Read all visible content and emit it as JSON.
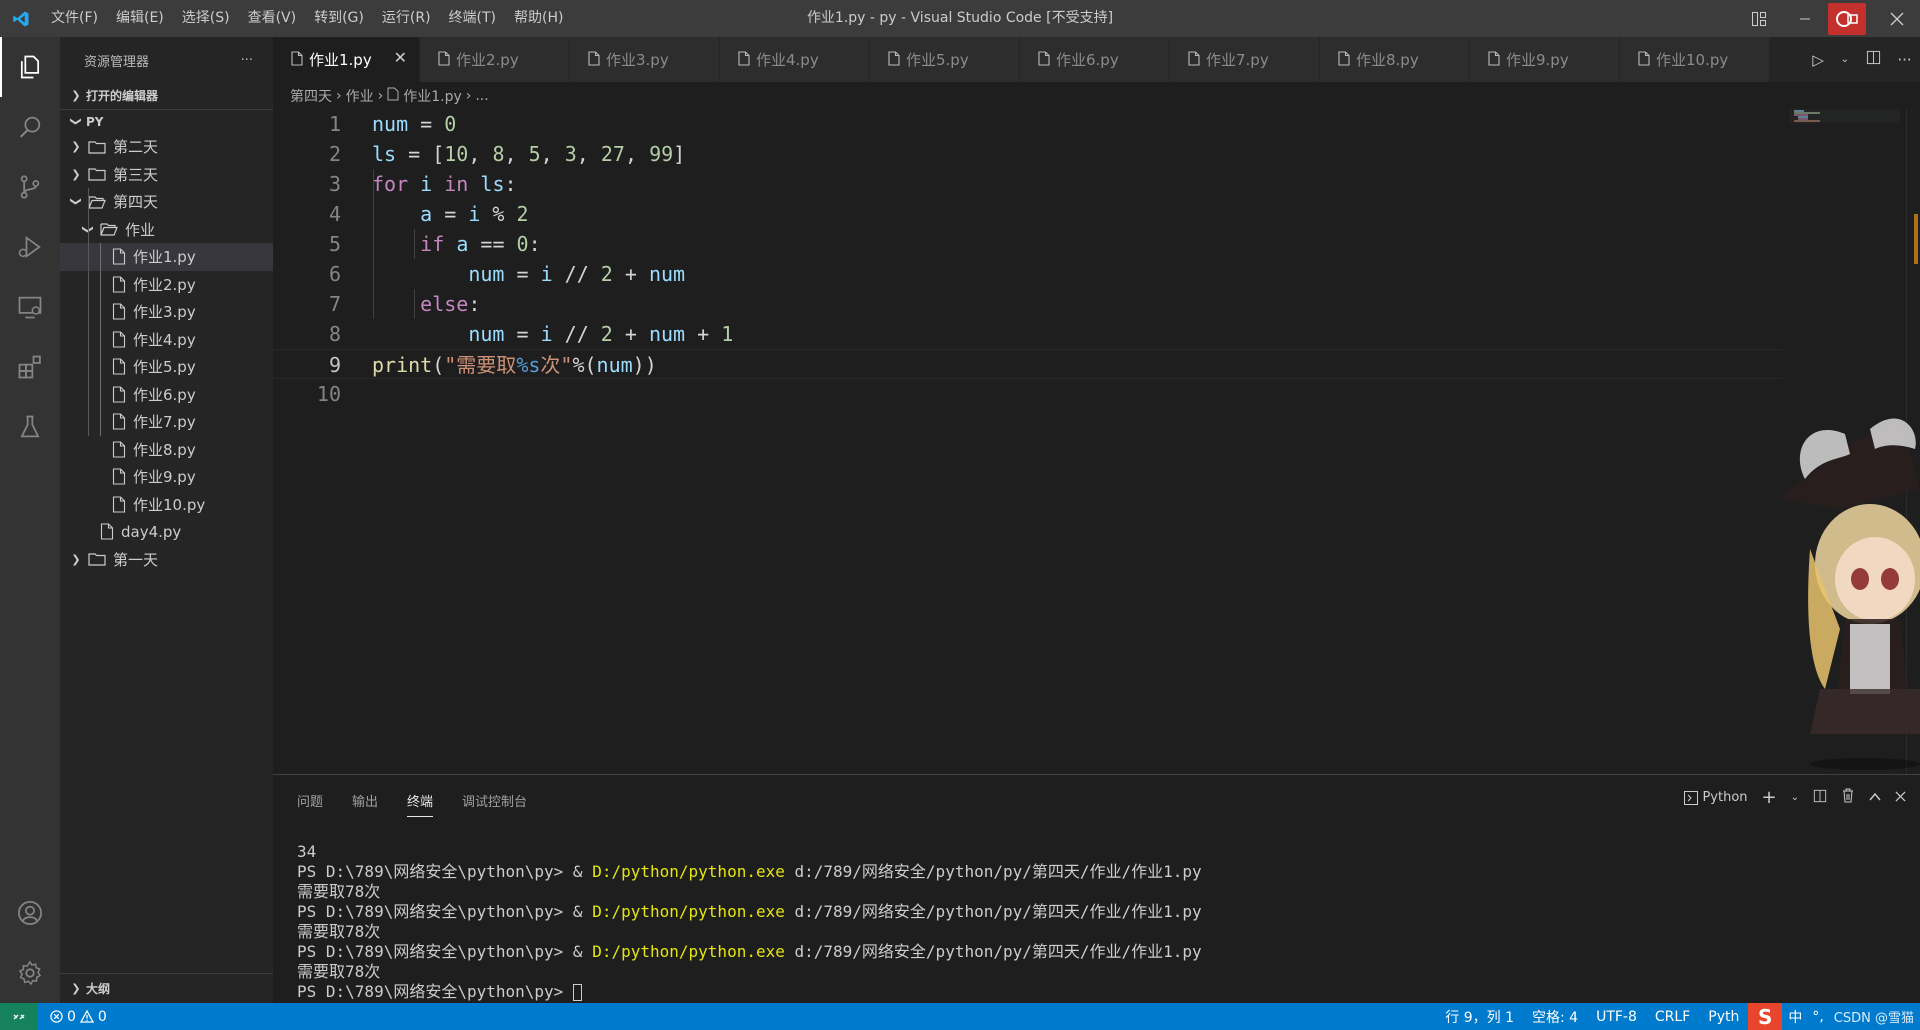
{
  "titlebar": {
    "menu": [
      "文件(F)",
      "编辑(E)",
      "选择(S)",
      "查看(V)",
      "转到(G)",
      "运行(R)",
      "终端(T)",
      "帮助(H)"
    ],
    "title": "作业1.py - py - Visual Studio Code [不受支持]"
  },
  "sidebar": {
    "header": "资源管理器",
    "more": "···",
    "open_editors": "打开的编辑器",
    "root": "PY",
    "tree": [
      {
        "label": "第二天",
        "type": "folder",
        "expanded": false,
        "depth": 1
      },
      {
        "label": "第三天",
        "type": "folder",
        "expanded": false,
        "depth": 1
      },
      {
        "label": "第四天",
        "type": "folder",
        "expanded": true,
        "depth": 1
      },
      {
        "label": "作业",
        "type": "folder",
        "expanded": true,
        "depth": 2
      },
      {
        "label": "作业1.py",
        "type": "file",
        "depth": 3,
        "selected": true
      },
      {
        "label": "作业2.py",
        "type": "file",
        "depth": 3
      },
      {
        "label": "作业3.py",
        "type": "file",
        "depth": 3
      },
      {
        "label": "作业4.py",
        "type": "file",
        "depth": 3
      },
      {
        "label": "作业5.py",
        "type": "file",
        "depth": 3
      },
      {
        "label": "作业6.py",
        "type": "file",
        "depth": 3
      },
      {
        "label": "作业7.py",
        "type": "file",
        "depth": 3
      },
      {
        "label": "作业8.py",
        "type": "file",
        "depth": 3
      },
      {
        "label": "作业9.py",
        "type": "file",
        "depth": 3
      },
      {
        "label": "作业10.py",
        "type": "file",
        "depth": 3
      },
      {
        "label": "day4.py",
        "type": "file",
        "depth": 2
      },
      {
        "label": "第一天",
        "type": "folder",
        "expanded": false,
        "depth": 1
      }
    ],
    "outline": "大纲"
  },
  "tabs": [
    "作业1.py",
    "作业2.py",
    "作业3.py",
    "作业4.py",
    "作业5.py",
    "作业6.py",
    "作业7.py",
    "作业8.py",
    "作业9.py",
    "作业10.py"
  ],
  "breadcrumb": {
    "a": "第四天",
    "b": "作业",
    "c": "作业1.py",
    "d": "..."
  },
  "editor": {
    "line_numbers": [
      "1",
      "2",
      "3",
      "4",
      "5",
      "6",
      "7",
      "8",
      "9",
      "10"
    ],
    "current_line": 9
  },
  "panel": {
    "tabs": [
      "问题",
      "输出",
      "终端",
      "调试控制台"
    ],
    "active_tab": "终端",
    "shell": "Python",
    "terminal": {
      "first": "34",
      "prompt": "PS D:\\789\\网络安全\\python\\py> & ",
      "exe": "D:/python/python.exe",
      "script": " d:/789/网络安全/python/py/第四天/作业/作业1.py",
      "output": "需要取78次",
      "last_prompt": "PS D:\\789\\网络安全\\python\\py> "
    }
  },
  "statusbar": {
    "errors": "0",
    "warnings": "0",
    "position": "行 9，列 1",
    "spaces": "空格: 4",
    "encoding": "UTF-8",
    "eol": "CRLF",
    "language": "Pyth",
    "ime": "中",
    "watermark": "CSDN @雪猫"
  },
  "colors": {
    "accent": "#007acc",
    "remote": "#16825d",
    "record": "#c4302b"
  }
}
